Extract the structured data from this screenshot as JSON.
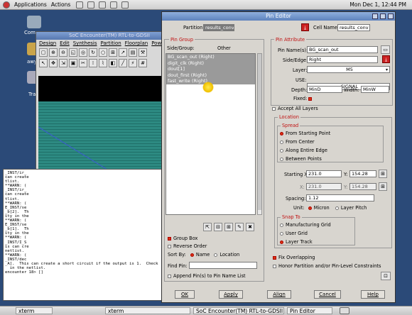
{
  "top_panel": {
    "menu1": "Applications",
    "menu2": "Actions",
    "clock": "Mon Dec  1, 12:44 PM"
  },
  "desktop": {
    "icon1_label": "Com",
    "icon2_label": "awyer'",
    "icon3_label": "Tra"
  },
  "taskbar": {
    "items": [
      "xterm",
      "xterm",
      "SoC Encounter(TM) RTL-to-GDSII",
      "Pin Editor"
    ]
  },
  "soc": {
    "title": "SoC Encounter(TM) RTL-to-GDSII",
    "menus": [
      "Design",
      "Edit",
      "Synthesis",
      "Partition",
      "Floorplan",
      "Power"
    ]
  },
  "xterm": {
    "lines": [
      "_INST/ir_",
      "can create",
      "tlist.",
      "**WARN: (",
      "_INST/ir_",
      "can create",
      "tlist.",
      "**WARN: (",
      "E_INST/se",
      "_b[2].  Th",
      "ity in the",
      "**WARN: (",
      "E_INST/se",
      "_b[1].  Th",
      "ity in the",
      "**WARN: (",
      "_INST/I_S",
      "is can cre",
      "netlist.",
      "**WARN: (",
      "_INST/dec",
      "_A].  This can create a short circuit if the output is 1.  Check",
      "  in the netlist.",
      "encounter 18> []"
    ]
  },
  "pin_editor": {
    "title": "Pin Editor",
    "partition_label": "Partition:",
    "partition_value": "results_conv",
    "cell_name_label": "Cell Name:",
    "cell_name_value": "results_conv",
    "pin_group_title": "Pin Group",
    "side_group_label": "Side/Group:",
    "other_label": "Other",
    "pins": [
      "BG_scan_out (Right)",
      "digit_clk (Right)",
      "dout[1]",
      "dout_first (Right)",
      "fast_write (Right)"
    ],
    "group_box_label": "Group Box",
    "reverse_order_label": "Reverse Order",
    "sort_by_label": "Sort By:",
    "sort_name": "Name",
    "sort_location": "Location",
    "find_pin_label": "Find Pin:",
    "append_label": "Append Pin(s) to Pin Name List",
    "pin_attribute_title": "Pin Attribute",
    "pin_names_label": "Pin Name(s):",
    "pin_names_value": "BG_scan_out",
    "side_edge_label": "Side/Edge:",
    "side_edge_value": "Right",
    "layer_label": "Layer:",
    "layer_value": "M5",
    "use_label": "USE:",
    "use_value": "SIGNAL",
    "depth_label": "Depth:",
    "depth_value": "MinD",
    "width_label": "Width:",
    "width_value": "MinW",
    "fixed_label": "Fixed:",
    "accept_all_layers_label": "Accept All Layers",
    "location_title": "Location",
    "spread_title": "Spread",
    "spread_options": [
      "From Starting Point",
      "From Center",
      "Along Entire Edge",
      "Between Points"
    ],
    "starting_label": "Starting X:",
    "start_x": "231.0",
    "start_y_label": "Y:",
    "start_y": "154.28",
    "end_label": "X:",
    "end_x": "231.0",
    "end_y_label": "Y:",
    "end_y": "154.28",
    "spacing_label": "Spacing:",
    "spacing_value": "1.12",
    "unit_label": "Unit:",
    "unit_micron": "Micron",
    "unit_layer_pitch": "Layer Pitch",
    "snap_to_title": "Snap To",
    "snap_options": [
      "Manufacturing Grid",
      "User Grid",
      "Layer Track"
    ],
    "fix_overlapping_label": "Fix Overlapping",
    "honor_label": "Honor Partition and/or Pin-Level Constraints",
    "buttons": {
      "ok": "OK",
      "apply": "Apply",
      "align": "Align",
      "cancel": "Cancel",
      "help": "Help"
    }
  },
  "colors": {
    "desktop": "#2b4a78",
    "accent_red": "#cc2222",
    "teal": "#2d8a82"
  }
}
